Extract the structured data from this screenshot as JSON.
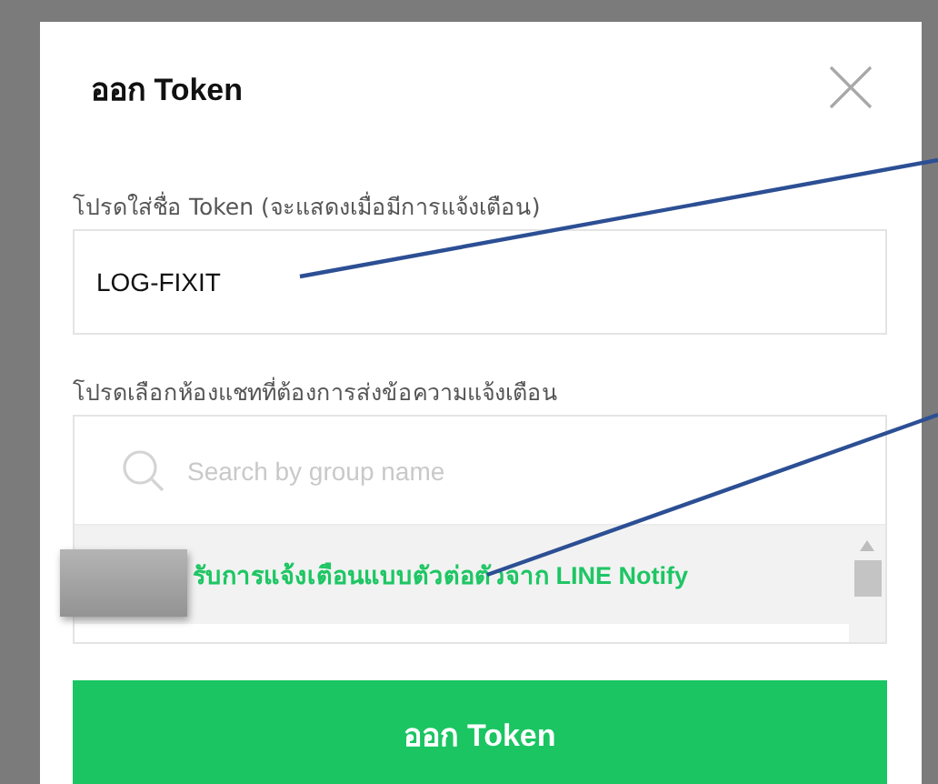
{
  "dialog": {
    "title": "ออก Token",
    "name_field": {
      "label": "โปรดใส่ชื่อ Token (จะแสดงเมื่อมีการแจ้งเตือน)",
      "value": "LOG-FIXIT"
    },
    "chat_picker": {
      "label": "โปรดเลือกห้องแชทที่ต้องการส่งข้อความแจ้งเตือน",
      "search_placeholder": "Search by group name",
      "items": [
        {
          "label": "รับการแจ้งเตือนแบบตัวต่อตัวจาก LINE Notify",
          "selected": true
        }
      ]
    },
    "submit_button": "ออก Token"
  }
}
